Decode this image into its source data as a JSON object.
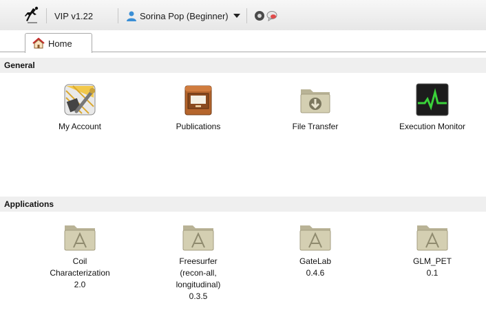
{
  "toolbar": {
    "logo_icon": "running-figure-logo-icon",
    "version": "VIP v1.22",
    "user_icon": "user-icon",
    "user_label": "Sorina Pop (Beginner)",
    "menu_icon": "chevron-down-icon",
    "button1_icon": "gray-circle-icon",
    "button2_icon": "chat-bubble-icon"
  },
  "tabs": [
    {
      "label": "Home",
      "icon": "home-icon",
      "active": true
    }
  ],
  "general": {
    "title": "General",
    "items": [
      {
        "label": "My Account",
        "icon": "account-tools-icon"
      },
      {
        "label": "Publications",
        "icon": "cabinet-drawer-icon"
      },
      {
        "label": "File Transfer",
        "icon": "download-folder-icon"
      },
      {
        "label": "Execution Monitor",
        "icon": "activity-monitor-icon"
      }
    ]
  },
  "applications": {
    "title": "Applications",
    "items": [
      {
        "name": "Coil",
        "name2": "Characterization",
        "name3": "",
        "version": "2.0",
        "icon": "app-folder-icon"
      },
      {
        "name": "Freesurfer",
        "name2": "(recon-all,",
        "name3": "longitudinal)",
        "version": "0.3.5",
        "icon": "app-folder-icon"
      },
      {
        "name": "GateLab",
        "name2": "",
        "name3": "",
        "version": "0.4.6",
        "icon": "app-folder-icon"
      },
      {
        "name": "GLM_PET",
        "name2": "",
        "name3": "",
        "version": "0.1",
        "icon": "app-folder-icon"
      }
    ]
  },
  "colors": {
    "section_bg": "#efefef",
    "folder": "#c9c4a5",
    "monitor_line": "#3ad23a"
  }
}
